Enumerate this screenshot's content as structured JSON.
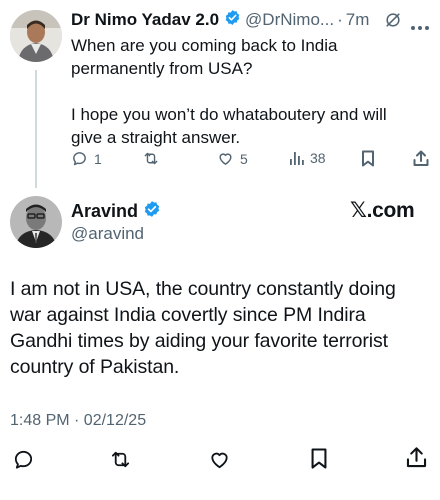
{
  "parent_tweet": {
    "display_name": "Dr Nimo Yadav 2.0",
    "handle": "@DrNimo...",
    "separator": "·",
    "time": "7m",
    "line1": "When are you coming back to India",
    "line2": "permanently from USA?",
    "line3": "I hope you won’t do whataboutery and will",
    "line4": "give a straight answer.",
    "replies": "1",
    "likes": "5",
    "views": "38"
  },
  "main_tweet": {
    "display_name": "Aravind",
    "handle": "@aravind",
    "brand": "𝕏.com",
    "line1": "I am not in USA, the country constantly doing",
    "line2": "war against India covertly since PM Indira",
    "line3": "Gandhi times by aiding your favorite terrorist",
    "line4": "country of Pakistan.",
    "timestamp": "1:48 PM · 02/12/25"
  },
  "icons": {
    "verified": "verified-badge-icon",
    "grok": "grok-icon",
    "more": "more-icon",
    "reply": "reply-icon",
    "retweet": "retweet-icon",
    "like": "like-icon",
    "views": "views-icon",
    "bookmark": "bookmark-icon",
    "share": "share-icon"
  },
  "colors": {
    "verified": "#1d9bf0",
    "text": "#0f1419",
    "muted": "#536471",
    "thread_line": "#cfd9de"
  }
}
